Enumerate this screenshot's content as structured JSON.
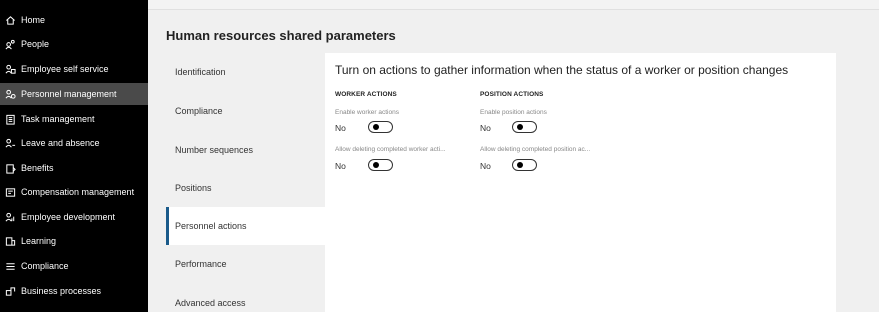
{
  "nav": {
    "items": [
      {
        "label": "Home",
        "icon": "home-icon",
        "active": false
      },
      {
        "label": "People",
        "icon": "people-icon",
        "active": false
      },
      {
        "label": "Employee self service",
        "icon": "self-service-icon",
        "active": false
      },
      {
        "label": "Personnel management",
        "icon": "personnel-icon",
        "active": true
      },
      {
        "label": "Task management",
        "icon": "task-icon",
        "active": false
      },
      {
        "label": "Leave and absence",
        "icon": "leave-icon",
        "active": false
      },
      {
        "label": "Benefits",
        "icon": "benefits-icon",
        "active": false
      },
      {
        "label": "Compensation management",
        "icon": "compensation-icon",
        "active": false
      },
      {
        "label": "Employee development",
        "icon": "development-icon",
        "active": false
      },
      {
        "label": "Learning",
        "icon": "learning-icon",
        "active": false
      },
      {
        "label": "Compliance",
        "icon": "compliance-icon",
        "active": false
      },
      {
        "label": "Business processes",
        "icon": "business-process-icon",
        "active": false
      }
    ]
  },
  "page": {
    "title": "Human resources shared parameters"
  },
  "tabs": [
    {
      "label": "Identification",
      "active": false
    },
    {
      "label": "Compliance",
      "active": false
    },
    {
      "label": "Number sequences",
      "active": false
    },
    {
      "label": "Positions",
      "active": false
    },
    {
      "label": "Personnel actions",
      "active": true
    },
    {
      "label": "Performance",
      "active": false
    },
    {
      "label": "Advanced access",
      "active": false
    }
  ],
  "panel": {
    "heading": "Turn on actions to gather information when the status of a worker or position changes",
    "worker": {
      "title": "WORKER ACTIONS",
      "enable_label": "Enable worker actions",
      "enable_value": "No",
      "delete_label": "Allow deleting completed worker acti...",
      "delete_value": "No"
    },
    "position": {
      "title": "POSITION ACTIONS",
      "enable_label": "Enable position actions",
      "enable_value": "No",
      "delete_label": "Allow deleting completed position ac...",
      "delete_value": "No"
    }
  },
  "colors": {
    "nav_bg": "#000000",
    "nav_active": "#4a4a4a",
    "tab_accent": "#1a5a8a"
  }
}
